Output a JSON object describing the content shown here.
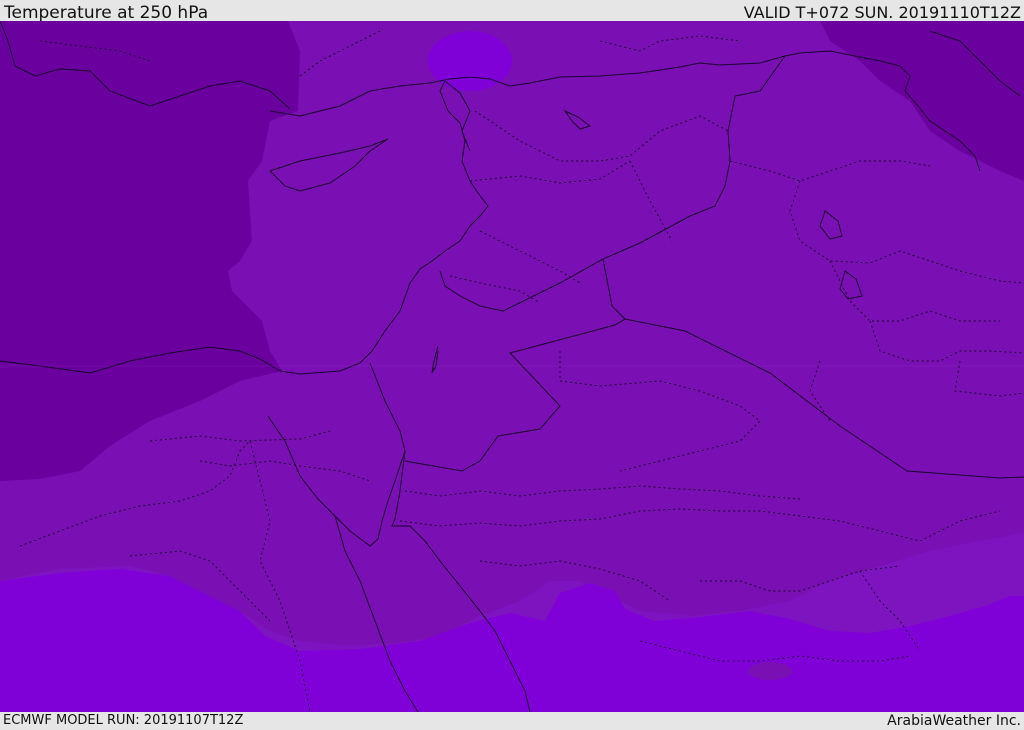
{
  "header": {
    "title": "Temperature at 250 hPa",
    "valid_time": "VALID T+072 SUN. 20191110T12Z"
  },
  "footer": {
    "model_run": "ECMWF MODEL RUN: 20191107T12Z",
    "credit": "ArabiaWeather Inc."
  },
  "colors": {
    "bg": "#e6e6e6",
    "band_coldest": "#6a009e",
    "band_cold": "#7a10b3",
    "band_mid": "#7e14c0",
    "band_warm": "#8000d8",
    "border_line": "#1a0030"
  }
}
